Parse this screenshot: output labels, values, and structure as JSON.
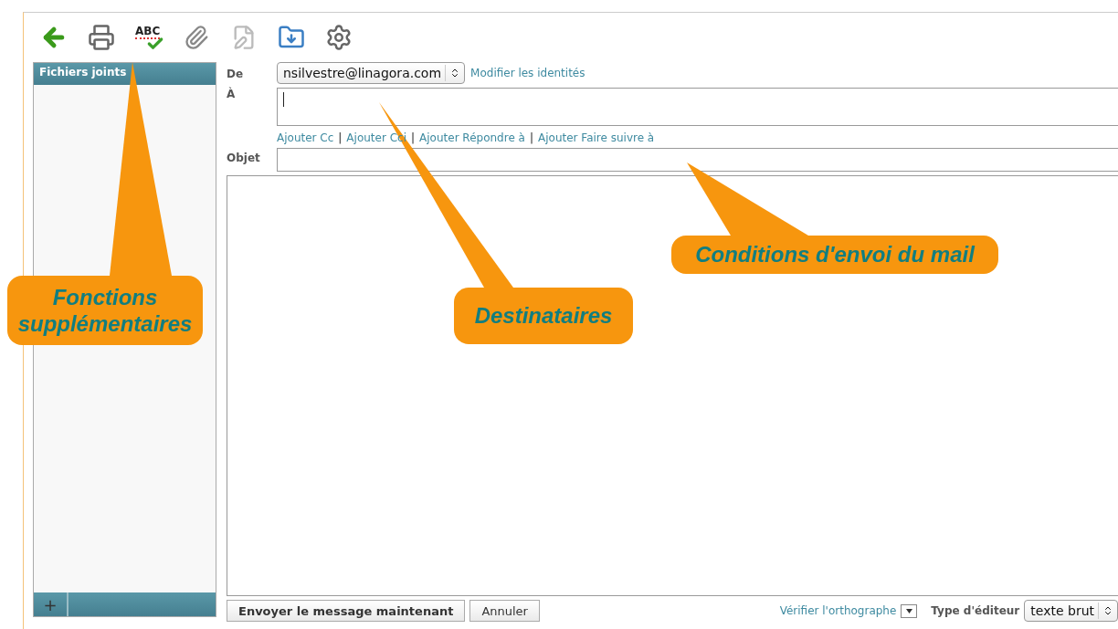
{
  "toolbar": {
    "spell_icon_label": "ABC"
  },
  "sidebar": {
    "title": "Fichiers joints",
    "add_button": "+"
  },
  "form": {
    "from_label": "De",
    "from_value": "nsilvestre@linagora.com",
    "identities_link": "Modifier les identités",
    "to_label": "À",
    "add_links": [
      "Ajouter Cc",
      "Ajouter Cci",
      "Ajouter Répondre à",
      "Ajouter Faire suivre à"
    ],
    "link_separators": [
      "|",
      "|",
      "|"
    ],
    "subject_label": "Objet"
  },
  "footer": {
    "send_button": "Envoyer le message maintenant",
    "cancel_button": "Annuler",
    "spellcheck_link": "Vérifier l'orthographe",
    "editor_label": "Type d'éditeur",
    "editor_value": "texte brut"
  },
  "callouts": [
    {
      "text": "Fonctions supplémentaires"
    },
    {
      "text": "Destinataires"
    },
    {
      "text": "Conditions d'envoi du mail"
    }
  ]
}
